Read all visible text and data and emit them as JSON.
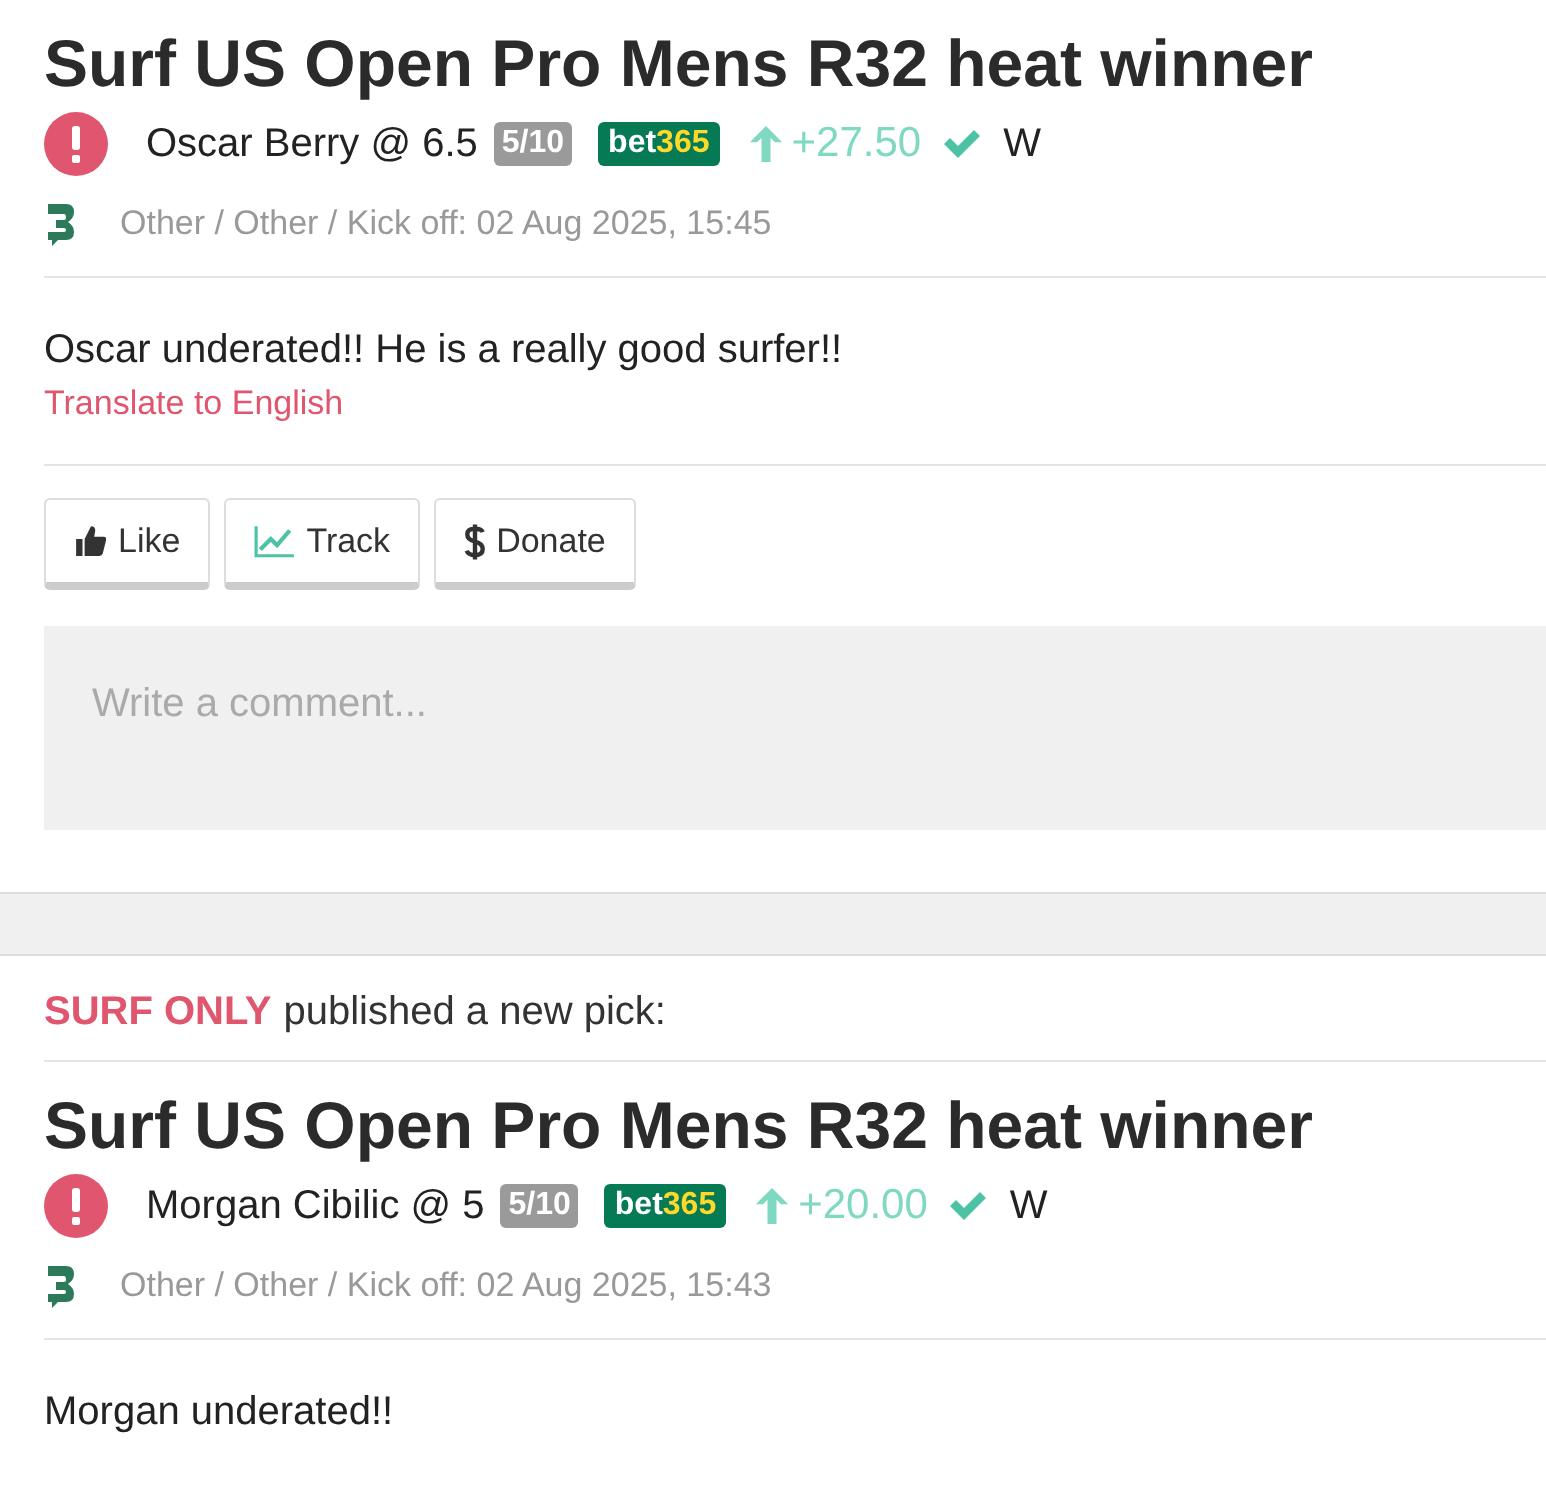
{
  "posts": [
    {
      "title": "Surf US Open Pro Mens R32 heat winner",
      "pick": {
        "selection": "Oscar Berry @ 6.5",
        "stake": "5/10",
        "bookmaker": [
          "bet",
          "365"
        ],
        "profit": "+27.50",
        "result": "W"
      },
      "meta": "Other / Other / Kick off: 02 Aug 2025, 15:45",
      "text": "Oscar underated!! He is a really good surfer!!",
      "translate": "Translate to English",
      "actions": [
        {
          "kind": "like",
          "label": "Like"
        },
        {
          "kind": "track",
          "label": "Track"
        },
        {
          "kind": "donate",
          "label": "Donate"
        }
      ],
      "comment_placeholder": "Write a comment..."
    },
    {
      "header": {
        "author": "SURF ONLY",
        "text": "published a new pick:"
      },
      "title": "Surf US Open Pro Mens R32 heat winner",
      "pick": {
        "selection": "Morgan Cibilic @ 5",
        "stake": "5/10",
        "bookmaker": [
          "bet",
          "365"
        ],
        "profit": "+20.00",
        "result": "W"
      },
      "meta": "Other / Other / Kick off: 02 Aug 2025, 15:43",
      "text": "Morgan underated!!"
    }
  ]
}
